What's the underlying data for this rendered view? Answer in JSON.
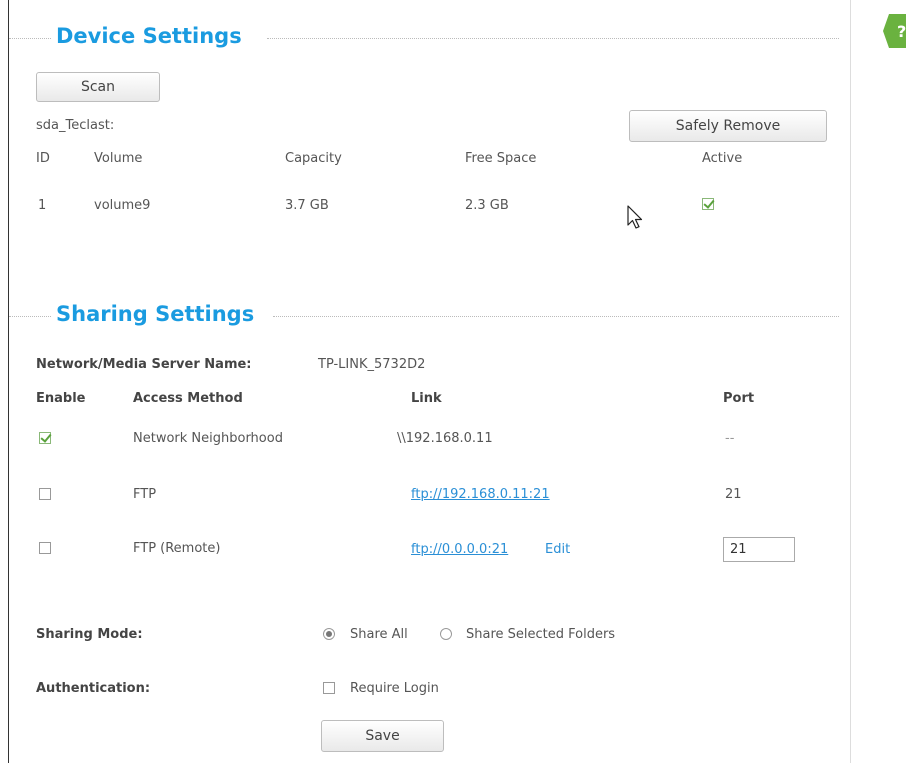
{
  "device_settings": {
    "title": "Device Settings",
    "scan_label": "Scan",
    "device_name": "sda_Teclast:",
    "safely_remove_label": "Safely Remove",
    "columns": {
      "id": "ID",
      "volume": "Volume",
      "capacity": "Capacity",
      "free_space": "Free Space",
      "active": "Active"
    },
    "rows": [
      {
        "id": "1",
        "volume": "volume9",
        "capacity": "3.7 GB",
        "free_space": "2.3 GB",
        "active": true
      }
    ]
  },
  "sharing_settings": {
    "title": "Sharing Settings",
    "server_name_label": "Network/Media Server Name:",
    "server_name_value": "TP-LINK_5732D2",
    "columns": {
      "enable": "Enable",
      "access_method": "Access Method",
      "link": "Link",
      "port": "Port"
    },
    "rows": [
      {
        "enabled": true,
        "method": "Network Neighborhood",
        "link": "\\\\192.168.0.11",
        "port": "--"
      },
      {
        "enabled": false,
        "method": "FTP",
        "link": "ftp://192.168.0.11:21",
        "port": "21"
      },
      {
        "enabled": false,
        "method": "FTP (Remote)",
        "link": "ftp://0.0.0.0:21",
        "edit_label": "Edit",
        "port_value": "21"
      }
    ],
    "sharing_mode": {
      "label": "Sharing Mode:",
      "options": [
        {
          "label": "Share All",
          "selected": true
        },
        {
          "label": "Share Selected Folders",
          "selected": false
        }
      ]
    },
    "authentication": {
      "label": "Authentication:",
      "require_login_label": "Require Login",
      "require_login_checked": false
    },
    "save_label": "Save"
  },
  "colors": {
    "accent": "#1a9be0",
    "link": "#2a8fd6",
    "check": "#5aa23c",
    "help_icon": "#6ab23f"
  },
  "icons": [
    "help-icon",
    "checkbox-check-icon",
    "mouse-cursor-icon"
  ]
}
